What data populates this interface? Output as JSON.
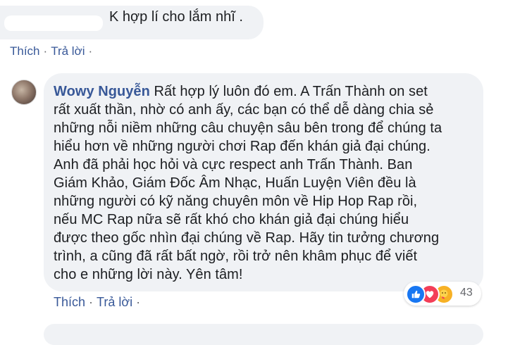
{
  "comment1": {
    "text": "K hợp lí cho lắm nhĩ ."
  },
  "comment1_actions": {
    "like": "Thích",
    "sep": "·",
    "reply": "Trả lời",
    "sep2": "·"
  },
  "comment2": {
    "author": "Wowy Nguyễn",
    "body": "Rất hợp lý luôn đó em. A Trấn Thành on set\nrất xuất thần, nhờ có anh ấy, các bạn có thể dễ dàng chia sẻ\nnhững nỗi niềm những câu chuyện sâu bên trong để chúng ta\nhiểu hơn về những người chơi Rap đến khán giả đại chúng.\nAnh đã phải học hỏi và cực respect anh Trấn Thành. Ban\nGiám Khảo, Giám Đốc Âm Nhạc, Huấn Luyện Viên đều là\nnhững người có kỹ năng chuyên môn về Hip Hop Rap rồi,\nnếu MC Rap nữa sẽ rất khó cho khán giả đại chúng hiểu\nđược theo gốc nhìn đại chúng về Rap. Hãy tin tưởng chương\ntrình, a cũng đã rất bất ngờ, rồi trở nên khâm phục để viết\ncho e những lời này. Yên tâm!"
  },
  "comment2_actions": {
    "like": "Thích",
    "sep": "·",
    "reply": "Trả lời",
    "sep2": "·"
  },
  "reactions": {
    "count": "43",
    "icons": [
      "like-icon",
      "love-icon",
      "care-icon"
    ],
    "colors": {
      "like": "#1877f2",
      "love": "#f33e58",
      "care": "#f7b125"
    }
  }
}
